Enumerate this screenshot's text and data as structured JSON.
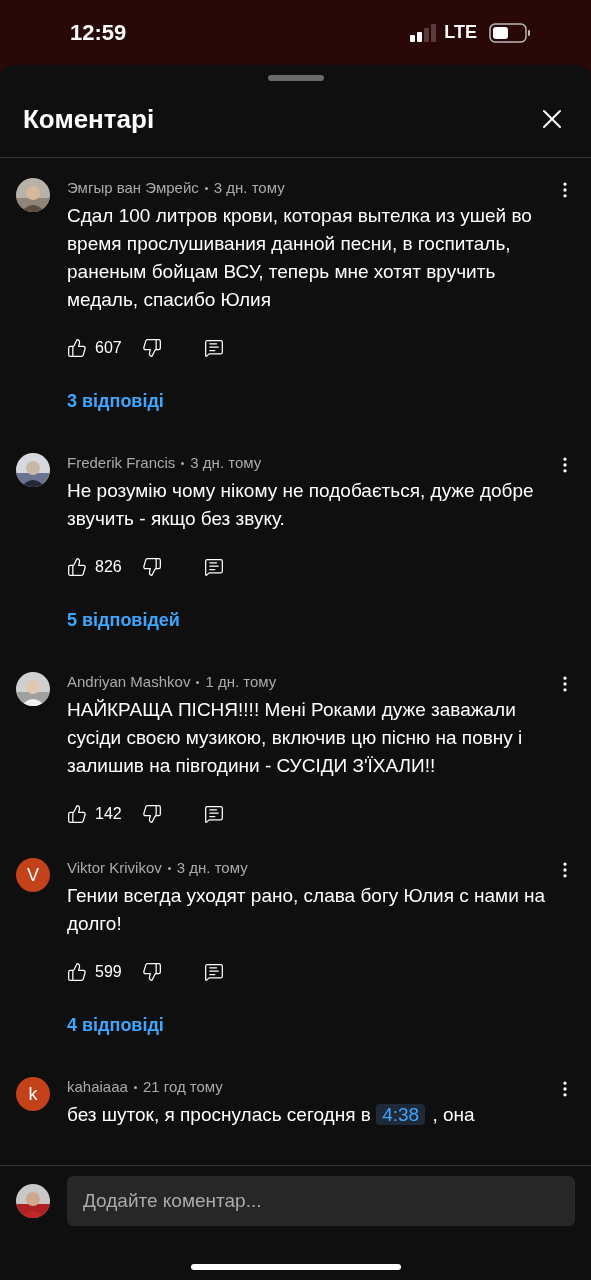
{
  "status_bar": {
    "time": "12:59",
    "network": "LTE"
  },
  "header": {
    "title": "Коментарі"
  },
  "comments": [
    {
      "author": "Эмгыр ван Эмрейс",
      "age": "3 дн. тому",
      "body": [
        {
          "kind": "text",
          "text": "Сдал 100 литров крови, которая вытелка из ушей во время прослушивания данной песни, в госпиталь, раненым бойцам ВСУ, теперь мне хотят вручить медаль, спасибо Юлия"
        }
      ],
      "likes": "607",
      "replies": "3 відповіді"
    },
    {
      "author": "Frederik Francis",
      "age": "3 дн. тому",
      "body": [
        {
          "kind": "text",
          "text": "Не розумію чому нікому не подобається, дуже добре звучить - якщо без звуку."
        }
      ],
      "likes": "826",
      "replies": "5 відповідей"
    },
    {
      "author": "Andriyan Mashkov",
      "age": "1 дн. тому",
      "body": [
        {
          "kind": "text",
          "text": "НАЙКРАЩА ПІСНЯ!!!! Мені Роками дуже заважали сусіди своєю музикою, включив цю пісню на повну і залишив на півгодини - СУСІДИ З'ЇХАЛИ!!"
        }
      ],
      "likes": "142"
    },
    {
      "author": "Viktor Krivikov",
      "age": "3 дн. тому",
      "avatar": {
        "kind": "letter",
        "letter": "V",
        "color": "#c4421a"
      },
      "body": [
        {
          "kind": "text",
          "text": "Гении всегда уходят рано, слава богу Юлия с нами на долго!"
        }
      ],
      "likes": "599",
      "replies": "4 відповіді"
    },
    {
      "author": "kahaiaaa",
      "age": "21 год тому",
      "avatar": {
        "kind": "letter",
        "letter": "k",
        "color": "#c4421a"
      },
      "body": [
        {
          "kind": "text",
          "text": "без шуток, я проснулась сегодня в"
        },
        {
          "kind": "timestamp",
          "text": "4:38"
        },
        {
          "kind": "text",
          "text": ", она"
        }
      ]
    }
  ],
  "composer": {
    "placeholder": "Додайте коментар..."
  }
}
